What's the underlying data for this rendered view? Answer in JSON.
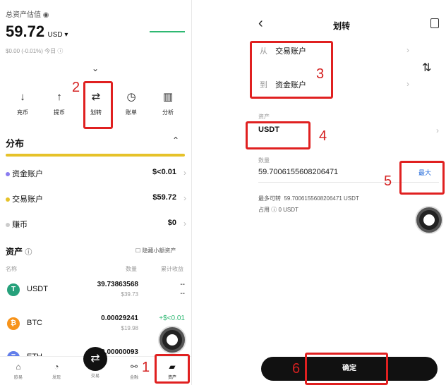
{
  "left": {
    "total_label": "总资产估值",
    "total_value": "59.72",
    "currency": "USD",
    "change": "$0.00 (-0.01%) 今日",
    "actions": [
      {
        "label": "充币",
        "icon": "↓"
      },
      {
        "label": "提币",
        "icon": "↑"
      },
      {
        "label": "划转",
        "icon": "⇄"
      },
      {
        "label": "账单",
        "icon": "◷"
      },
      {
        "label": "分析",
        "icon": "▥"
      }
    ],
    "distribution_title": "分布",
    "distribution": [
      {
        "name": "资金账户",
        "value": "$<0.01",
        "color": "#8a7cf0"
      },
      {
        "name": "交易账户",
        "value": "$59.72",
        "color": "#e6c229"
      },
      {
        "name": "赚币",
        "value": "$0",
        "color": "#cccccc"
      }
    ],
    "assets_title": "资产",
    "hide_small": "隐藏小额资产",
    "col_name": "名称",
    "col_qty": "数量",
    "col_pnl": "累计收益",
    "assets": [
      {
        "symbol": "USDT",
        "qty": "39.73863568",
        "usd": "$39.73",
        "pnl": "--",
        "pnl2": "--",
        "icon_color": "#26a17b",
        "icon_char": "T"
      },
      {
        "symbol": "BTC",
        "qty": "0.00029241",
        "usd": "$19.98",
        "pnl": "+$<0.01",
        "pnl2": "",
        "icon_color": "#f7931a",
        "icon_char": "₿"
      },
      {
        "symbol": "ETH",
        "qty": "0.00000093",
        "usd": "",
        "pnl": "",
        "pnl2": "",
        "icon_color": "#627eea",
        "icon_char": "Ξ"
      }
    ],
    "nav": [
      {
        "label": "欧易",
        "icon": "⌂"
      },
      {
        "label": "发现",
        "icon": "◔"
      },
      {
        "label": "交易",
        "icon": "⇄"
      },
      {
        "label": "金融",
        "icon": "⚯"
      },
      {
        "label": "资产",
        "icon": "▰"
      }
    ]
  },
  "right": {
    "back": "‹",
    "title": "划转",
    "from_label": "从",
    "from_value": "交易账户",
    "to_label": "到",
    "to_value": "资金账户",
    "swap_icon": "⇅",
    "asset_label": "资产",
    "asset_value": "USDT",
    "qty_label": "数量",
    "qty_value": "59.7006155608206471",
    "max_label": "最大",
    "available_label": "最多可转",
    "available_value": "59.7006155608206471 USDT",
    "occupied_label": "占用",
    "occupied_value": "0 USDT",
    "confirm": "确定"
  },
  "annotations": [
    "1",
    "2",
    "3",
    "4",
    "5",
    "6"
  ]
}
